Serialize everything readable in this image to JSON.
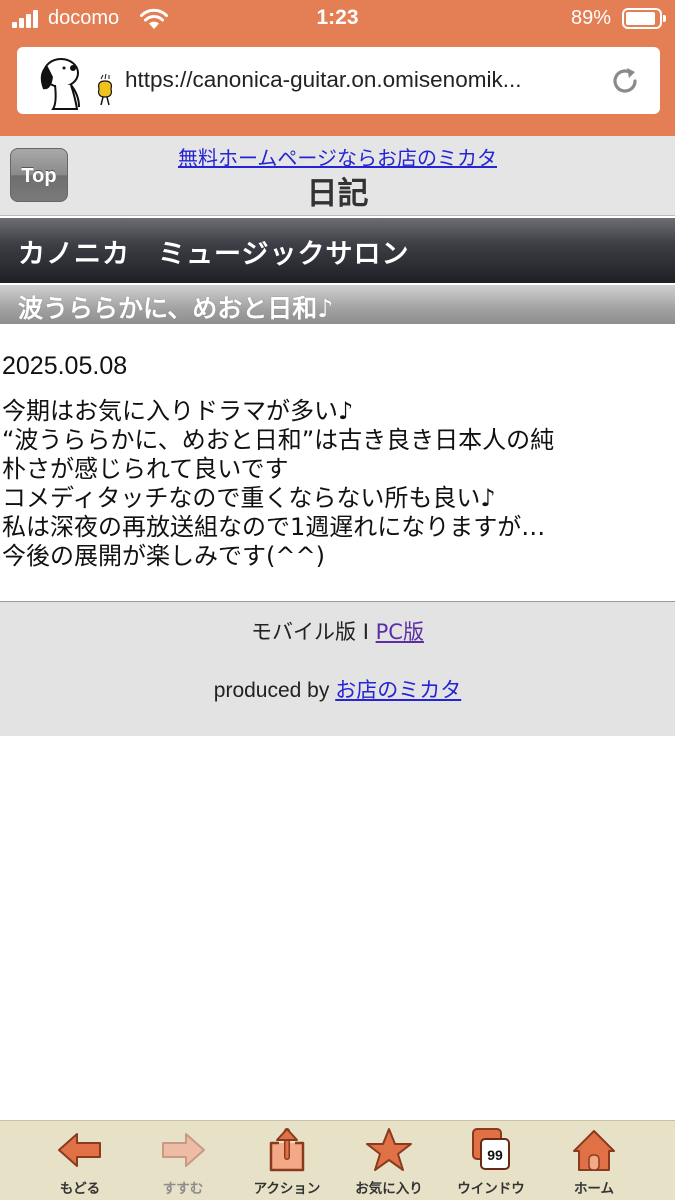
{
  "status_bar": {
    "carrier": "docomo",
    "time": "1:23",
    "battery": "89%"
  },
  "browser": {
    "url": "https://canonica-guitar.on.omisenomik..."
  },
  "header": {
    "top_button": "Top",
    "ad_link": "無料ホームページならお店のミカタ",
    "page_title": "日記"
  },
  "shop": {
    "name": "カノニカ　ミュージックサロン"
  },
  "post": {
    "title": "波うららかに、めおと日和♪",
    "date": "2025.05.08",
    "lines": [
      "今期はお気に入りドラマが多い♪",
      "“波うららかに、めおと日和”は古き良き日本人の純",
      "朴さが感じられて良いです",
      "コメディタッチなので重くならない所も良い♪",
      "私は深夜の再放送組なので1週遅れになりますが…",
      "今後の展開が楽しみです(^^)"
    ]
  },
  "footer": {
    "mobile_label": "モバイル版",
    "separator": "I",
    "pc_link": "PC版",
    "produced_by": "produced by",
    "producer_link": "お店のミカタ"
  },
  "toolbar": {
    "back": "もどる",
    "forward": "すすむ",
    "action": "アクション",
    "favorites": "お気に入り",
    "windows": "ウインドウ",
    "windows_count": "99",
    "home": "ホーム"
  },
  "colors": {
    "chrome": "#e47e55",
    "toolbar": "#e7e2c7",
    "toolbar_icon": "#e07046",
    "link": "#2525d5"
  }
}
